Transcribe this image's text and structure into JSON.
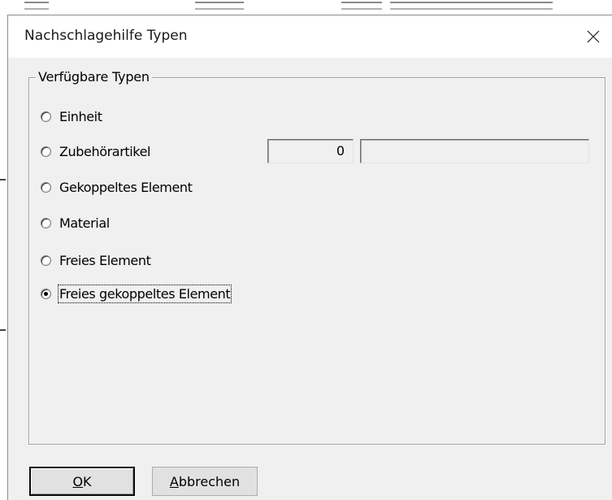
{
  "dialog": {
    "title": "Nachschlagehilfe Typen",
    "close_icon": "close-icon"
  },
  "group": {
    "legend": "Verfügbare Typen",
    "options": [
      {
        "label": "Einheit",
        "checked": false
      },
      {
        "label": "Zubehörartikel",
        "checked": false
      },
      {
        "label": "Gekoppeltes Element",
        "checked": false
      },
      {
        "label": "Material",
        "checked": false
      },
      {
        "label": "Freies Element",
        "checked": false
      },
      {
        "label": "Freies gekoppeltes Element",
        "checked": true
      }
    ],
    "number_value": "0",
    "text_value": ""
  },
  "buttons": {
    "ok_mnemonic": "O",
    "ok_rest": "K",
    "cancel_mnemonic": "A",
    "cancel_rest": "bbrechen"
  }
}
